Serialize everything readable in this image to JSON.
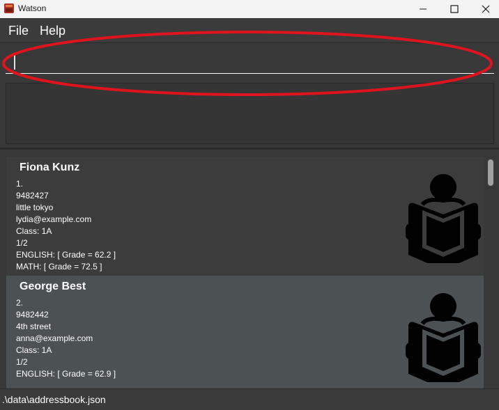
{
  "window": {
    "title": "Watson"
  },
  "menu": {
    "file": "File",
    "help": "Help"
  },
  "command": {
    "value": "",
    "placeholder": ""
  },
  "result": {
    "text": ""
  },
  "students": [
    {
      "name": "Fiona Kunz",
      "lines": [
        "1.",
        "9482427",
        "little tokyo",
        "lydia@example.com",
        "Class: 1A",
        "1/2",
        "ENGLISH: [ Grade = 62.2 ]",
        "MATH: [ Grade = 72.5 ]"
      ],
      "icon": "reading-student-icon"
    },
    {
      "name": "George Best",
      "lines": [
        "2.",
        "9482442",
        "4th street",
        "anna@example.com",
        "Class: 1A",
        "1/2",
        "ENGLISH: [ Grade = 62.9 ]"
      ],
      "icon": "reading-student-icon"
    }
  ],
  "status": {
    "file_path": ".\\data\\addressbook.json"
  },
  "colors": {
    "background": "#383838",
    "card_odd": "#3c3c3c",
    "card_selected": "#4c5154",
    "annotation": "#e0141e"
  }
}
